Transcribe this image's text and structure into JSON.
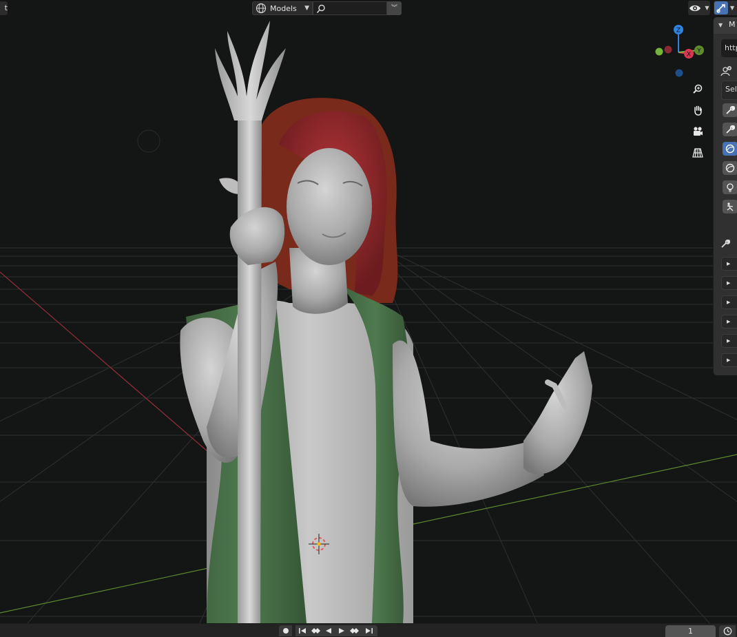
{
  "header": {
    "left_tab_label": "t",
    "collection_label": "Models",
    "search_placeholder": ""
  },
  "sidebar": {
    "title": "M",
    "url_value": "http",
    "select_label": "Sele",
    "play_rows": 6
  },
  "gizmo": {
    "x": "X",
    "y": "Y",
    "z": "Z"
  },
  "timeline": {
    "current_frame": "1"
  },
  "colors": {
    "x_axis": "#d93850",
    "y_axis": "#7eb83a",
    "z_axis": "#2f82e0",
    "accent": "#4772b3"
  },
  "icons": [
    "globe-icon",
    "search-icon",
    "eye-icon",
    "gizmo-toggle-icon",
    "zoom-icon",
    "hand-icon",
    "camera-icon",
    "grid-icon",
    "wrench-icon",
    "sphere-icon",
    "bulb-icon",
    "armature-icon",
    "record-icon",
    "jump-start-icon",
    "prev-keyframe-icon",
    "play-reverse-icon",
    "play-icon",
    "next-keyframe-icon",
    "jump-end-icon",
    "clock-icon"
  ]
}
